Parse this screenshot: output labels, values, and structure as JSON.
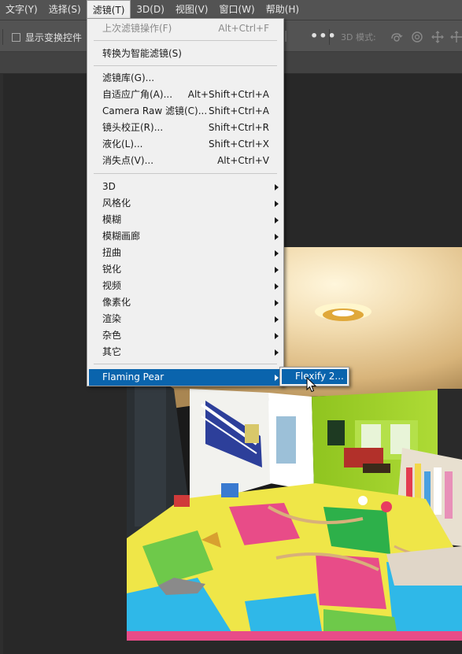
{
  "menubar": {
    "items": [
      {
        "label": "文字(Y)"
      },
      {
        "label": "选择(S)"
      },
      {
        "label": "滤镜(T)"
      },
      {
        "label": "3D(D)"
      },
      {
        "label": "视图(V)"
      },
      {
        "label": "窗口(W)"
      },
      {
        "label": "帮助(H)"
      }
    ],
    "active_index": 2
  },
  "options_bar": {
    "show_transform_label": "显示变换控件",
    "show_transform_checked": false,
    "more_label": "•••",
    "mode_label": "3D 模式:",
    "mode_icons": [
      "orbit-3d-icon",
      "roll-3d-icon",
      "pan-3d-icon",
      "slide-3d-icon"
    ]
  },
  "filter_menu": {
    "last_filter": {
      "label": "上次滤镜操作(F)",
      "shortcut": "Alt+Ctrl+F",
      "disabled": true
    },
    "convert_smart": {
      "label": "转换为智能滤镜(S)"
    },
    "group1": [
      {
        "label": "滤镜库(G)...",
        "shortcut": ""
      },
      {
        "label": "自适应广角(A)...",
        "shortcut": "Alt+Shift+Ctrl+A"
      },
      {
        "label": "Camera Raw 滤镜(C)...",
        "shortcut": "Shift+Ctrl+A"
      },
      {
        "label": "镜头校正(R)...",
        "shortcut": "Shift+Ctrl+R"
      },
      {
        "label": "液化(L)...",
        "shortcut": "Shift+Ctrl+X"
      },
      {
        "label": "消失点(V)...",
        "shortcut": "Alt+Ctrl+V"
      }
    ],
    "submenus": [
      {
        "label": "3D"
      },
      {
        "label": "风格化"
      },
      {
        "label": "模糊"
      },
      {
        "label": "模糊画廊"
      },
      {
        "label": "扭曲"
      },
      {
        "label": "锐化"
      },
      {
        "label": "视频"
      },
      {
        "label": "像素化"
      },
      {
        "label": "渲染"
      },
      {
        "label": "杂色"
      },
      {
        "label": "其它"
      }
    ],
    "plugin": {
      "label": "Flaming Pear",
      "highlighted": true
    }
  },
  "flaming_pear_submenu": {
    "items": [
      {
        "label": "Flexify 2...",
        "highlighted": true
      }
    ]
  },
  "colors": {
    "menu_highlight": "#0a64ad",
    "menu_bg": "#f0f0f0",
    "workspace_bg": "#282828",
    "toolbar_bg": "#535353"
  }
}
